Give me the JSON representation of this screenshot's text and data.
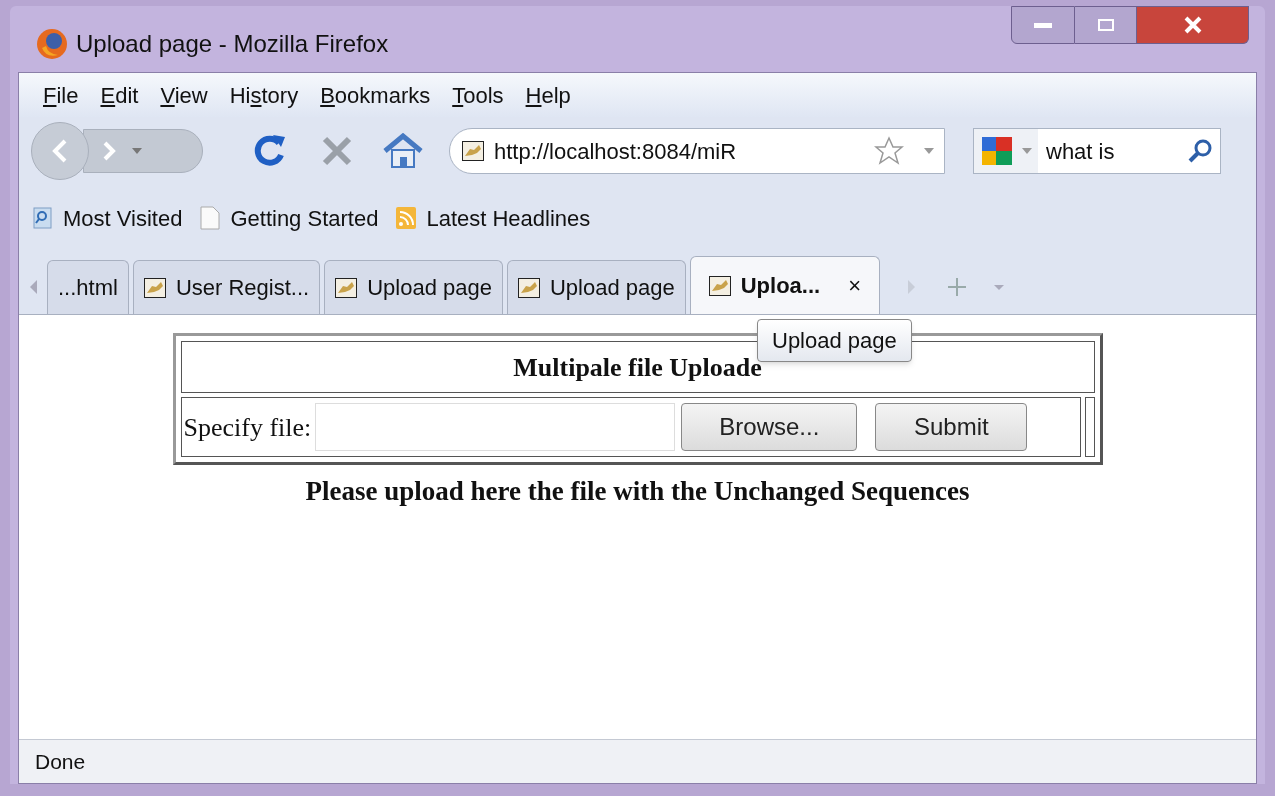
{
  "window": {
    "title": "Upload page - Mozilla Firefox"
  },
  "menu": [
    {
      "key": "F",
      "post": "ile"
    },
    {
      "key": "E",
      "post": "dit"
    },
    {
      "key": "V",
      "post": "iew"
    },
    {
      "pre": "Hi",
      "key": "s",
      "post": "tory"
    },
    {
      "key": "B",
      "post": "ookmarks"
    },
    {
      "key": "T",
      "post": "ools"
    },
    {
      "key": "H",
      "post": "elp"
    }
  ],
  "address": {
    "value": "http://localhost:8084/miR"
  },
  "search": {
    "value": "what is"
  },
  "bookmarks": [
    {
      "label": "Most Visited",
      "kind": "search"
    },
    {
      "label": "Getting Started",
      "kind": "page"
    },
    {
      "label": "Latest Headlines",
      "kind": "feed"
    }
  ],
  "tabs": [
    {
      "label": "...html",
      "selected": false,
      "has_icon": false
    },
    {
      "label": "User Regist...",
      "selected": false,
      "has_icon": true
    },
    {
      "label": "Upload page",
      "selected": false,
      "has_icon": true
    },
    {
      "label": "Upload page",
      "selected": false,
      "has_icon": true
    },
    {
      "label": "Uploa...",
      "selected": true,
      "has_icon": true,
      "close": "×"
    }
  ],
  "tooltip": "Upload page",
  "form": {
    "heading": "Multipale file Uploade",
    "label": "Specify file:",
    "buttons": [
      "Browse...",
      "Submit"
    ]
  },
  "note": "Please upload here the file with the Unchanged Sequences",
  "status_bar": {
    "text": "Done"
  }
}
